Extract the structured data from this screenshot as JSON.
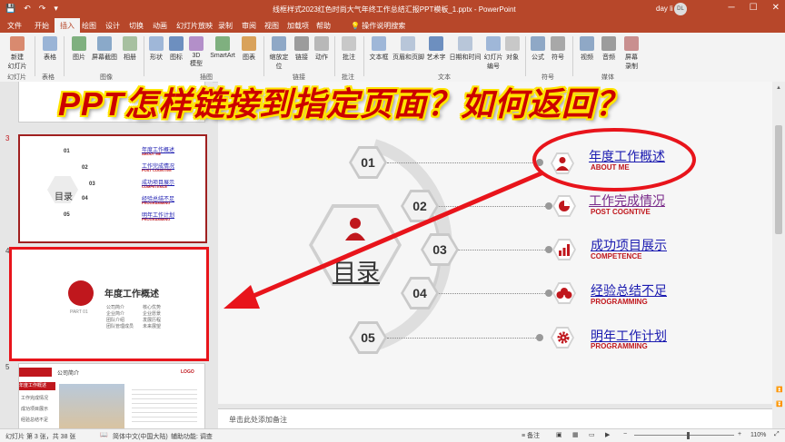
{
  "window": {
    "title": "线框样式2023红色时尚大气年终工作总结汇报PPT模板_1.pptx  -  PowerPoint",
    "user": "day li",
    "avatar": "DL",
    "qat": [
      "💾",
      "↶",
      "↷",
      "▾"
    ],
    "controls": [
      "─",
      "☐",
      "✕"
    ]
  },
  "ribbon_tabs": [
    "文件",
    "开始",
    "插入",
    "绘图",
    "设计",
    "切换",
    "动画",
    "幻灯片放映",
    "录制",
    "审阅",
    "视图",
    "加载项",
    "帮助",
    "操作说明搜索"
  ],
  "ribbon_tab_active": "插入",
  "ribbon": {
    "buttons": [
      "新建\n幻灯片",
      "表格",
      "图片",
      "屏幕截图",
      "相册",
      "形状",
      "图标",
      "3D\n模型",
      "SmartArt",
      "图表",
      "缩放定\n位",
      "链接",
      "动作",
      "批注",
      "文本框",
      "页眉和页脚",
      "艺术字",
      "日期和时间",
      "幻灯片\n编号",
      "对象",
      "公式",
      "符号",
      "视频",
      "音频",
      "屏幕\n录制"
    ],
    "groups": [
      "幻灯片",
      "表格",
      "图像",
      "插图",
      "链接",
      "批注",
      "文本",
      "符号",
      "媒体"
    ]
  },
  "overlay_title": "PPT怎样链接到指定页面？如何返回？",
  "thumbnails": {
    "slide3": {
      "num": "3",
      "center": "目录",
      "nums": [
        "01",
        "02",
        "03",
        "04",
        "05"
      ],
      "items": [
        "年度工作概述",
        "工作完成情况",
        "成功项目展示",
        "经验总结不足",
        "明年工作计划"
      ],
      "subs": [
        "ABOUT ME",
        "POST COGNTIVE",
        "COMPETENCE",
        "PROGRAMMING",
        "PROGRAMMING"
      ]
    },
    "slide4": {
      "num": "4",
      "part": "PART 01",
      "title": "年度工作概述",
      "bullets": [
        "公司简介",
        "核心优势",
        "企业简介",
        "企业愿景",
        "团队介绍",
        "发展历程",
        "团队管理成员",
        "未来展望"
      ]
    },
    "slide5": {
      "num": "5",
      "header": "公司简介",
      "logo": "LOGO",
      "menu": [
        "年度工作概述",
        "工作完成情况",
        "成功项目展示",
        "经验总结不足"
      ]
    }
  },
  "slide": {
    "center_label": "目录",
    "numbers": [
      "01",
      "02",
      "03",
      "04",
      "05"
    ],
    "items": [
      {
        "title": "年度工作概述",
        "sub": "ABOUT ME",
        "icon": "person-icon",
        "visited": false
      },
      {
        "title": "工作完成情况",
        "sub": "POST COGNTIVE",
        "icon": "pie-chart-icon",
        "visited": true
      },
      {
        "title": "成功项目展示",
        "sub": "COMPETENCE",
        "icon": "bar-chart-icon",
        "visited": false
      },
      {
        "title": "经验总结不足",
        "sub": "PROGRAMMING",
        "icon": "money-bag-icon",
        "visited": false
      },
      {
        "title": "明年工作计划",
        "sub": "PROGRAMMING",
        "icon": "gear-icon",
        "visited": false
      }
    ]
  },
  "notes_placeholder": "单击此处添加备注",
  "status": {
    "slide_info": "幻灯片 第 3 张，共 38 张",
    "language": "简体中文(中国大陆)",
    "accessibility": "辅助功能: 调查",
    "notes": "备注",
    "zoom": "110%"
  },
  "colors": {
    "brand": "#b7472a",
    "accent": "#c0171d",
    "annotation": "#e8141b",
    "link": "#1a1ab0"
  }
}
